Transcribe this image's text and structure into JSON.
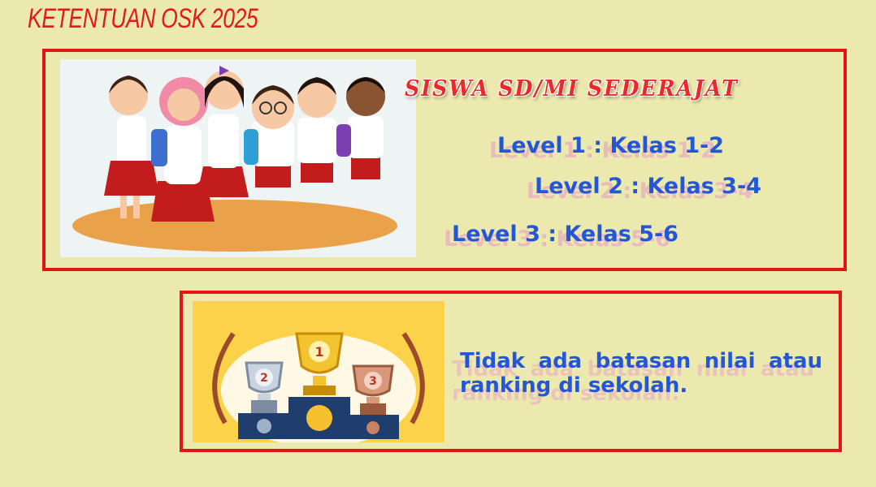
{
  "title": "KETENTUAN OSK 2025",
  "section1": {
    "heading": "SISWA SD/MI SEDERAJAT",
    "levels": [
      {
        "label": "Level 1 : Kelas 1-2"
      },
      {
        "label": "Level 2 : Kelas 3-4"
      },
      {
        "label": "Level 3 : Kelas 5-6"
      }
    ],
    "image_icon": "students-illustration-icon"
  },
  "section2": {
    "note": "Tidak ada batasan nilai atau ranking di sekolah.",
    "image_icon": "trophy-podium-icon",
    "trophy_labels": [
      "1",
      "2",
      "3"
    ]
  },
  "colors": {
    "background": "#ece9ae",
    "border": "#e41414",
    "title": "#e21a1a",
    "text_blue": "#2457d6"
  }
}
